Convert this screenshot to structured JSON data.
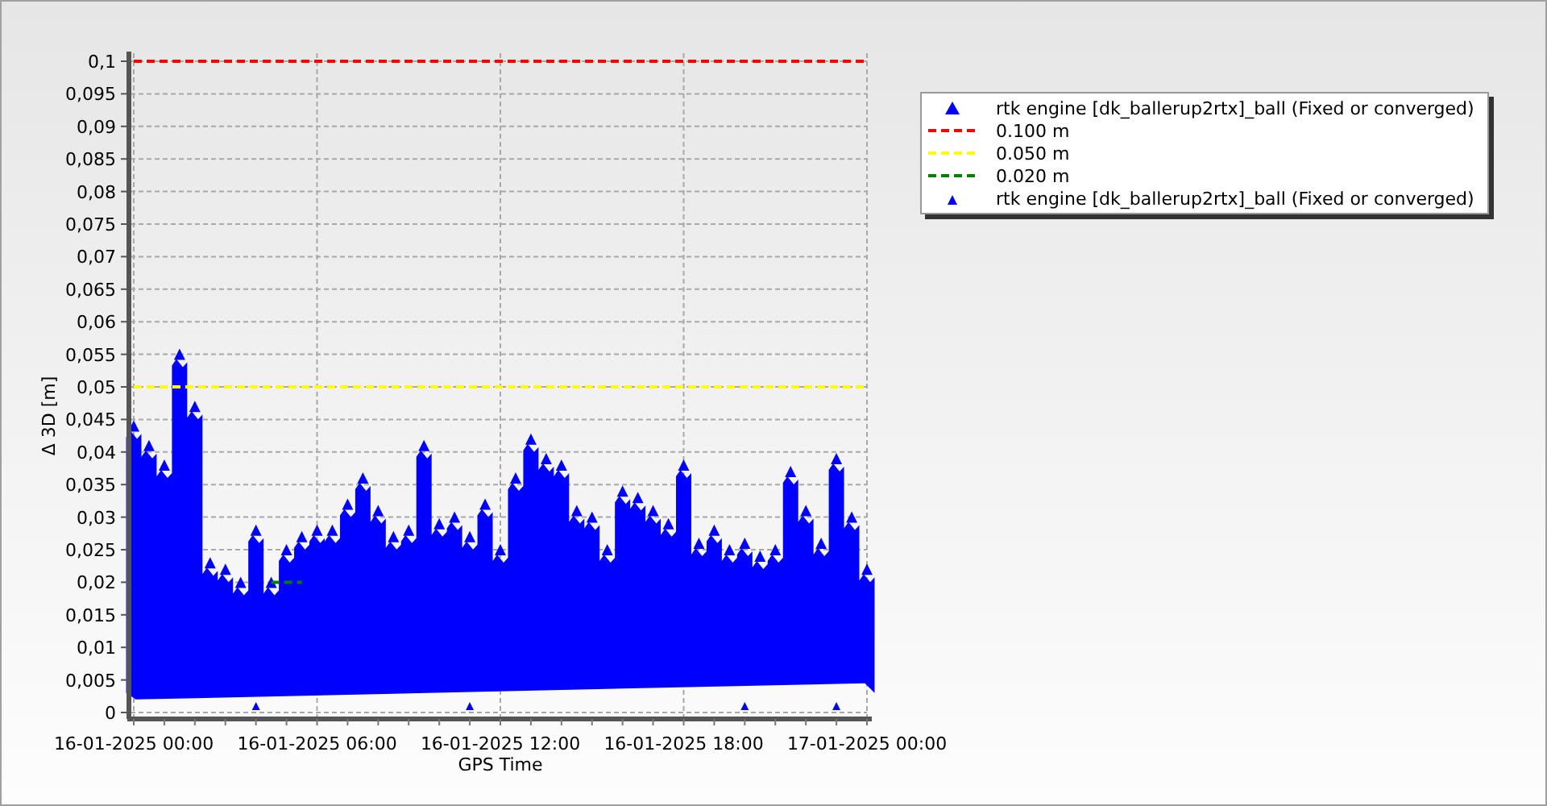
{
  "chart_data": {
    "type": "scatter",
    "grid": true,
    "xlabel": "GPS Time",
    "ylabel": "Δ 3D [m]",
    "categories": [
      "16-01-2025 00:00",
      null,
      null,
      null,
      null,
      null,
      null,
      null,
      null,
      null,
      null,
      null,
      "16-01-2025 06:00",
      null,
      null,
      null,
      null,
      null,
      null,
      null,
      null,
      null,
      null,
      null,
      "16-01-2025 12:00",
      null,
      null,
      null,
      null,
      null,
      null,
      null,
      null,
      null,
      null,
      null,
      "16-01-2025 18:00",
      null,
      null,
      null,
      null,
      null,
      null,
      null,
      null,
      null,
      null,
      null,
      "17-01-2025 00:00"
    ],
    "ylim": [
      0,
      0.1
    ],
    "yticks": [
      {
        "value": 0,
        "label": "0"
      },
      {
        "value": 0.005,
        "label": "0,005"
      },
      {
        "value": 0.01,
        "label": "0,01"
      },
      {
        "value": 0.015,
        "label": "0,015"
      },
      {
        "value": 0.02,
        "label": "0,02"
      },
      {
        "value": 0.025,
        "label": "0,025"
      },
      {
        "value": 0.03,
        "label": "0,03"
      },
      {
        "value": 0.035,
        "label": "0,035"
      },
      {
        "value": 0.04,
        "label": "0,04"
      },
      {
        "value": 0.045,
        "label": "0,045"
      },
      {
        "value": 0.05,
        "label": "0,05"
      },
      {
        "value": 0.055,
        "label": "0,055"
      },
      {
        "value": 0.06,
        "label": "0,06"
      },
      {
        "value": 0.065,
        "label": "0,065"
      },
      {
        "value": 0.07,
        "label": "0,07"
      },
      {
        "value": 0.075,
        "label": "0,075"
      },
      {
        "value": 0.08,
        "label": "0,08"
      },
      {
        "value": 0.085,
        "label": "0,085"
      },
      {
        "value": 0.09,
        "label": "0,09"
      },
      {
        "value": 0.095,
        "label": "0,095"
      },
      {
        "value": 0.1,
        "label": "0,1"
      }
    ],
    "series": [
      {
        "name": "rtk engine [dk_ballerup2rtx]_ball (Fixed or converged)",
        "type": "scatter",
        "marker": "triangle",
        "color": "#0000ff",
        "values": [
          0.044,
          0.041,
          0.038,
          0.055,
          0.047,
          0.023,
          0.022,
          0.02,
          0.028,
          0.02,
          0.025,
          0.027,
          0.028,
          0.028,
          0.032,
          0.036,
          0.031,
          0.027,
          0.028,
          0.041,
          0.029,
          0.03,
          0.027,
          0.032,
          0.025,
          0.036,
          0.042,
          0.039,
          0.038,
          0.031,
          0.03,
          0.025,
          0.034,
          0.033,
          0.031,
          0.029,
          0.038,
          0.026,
          0.028,
          0.025,
          0.026,
          0.024,
          0.025,
          0.037,
          0.031,
          0.026,
          0.039,
          0.03,
          0.022
        ]
      },
      {
        "name": "0.100 m",
        "type": "line",
        "line_style": "dashed",
        "color": "#ff0000",
        "values": [
          0.1,
          0.1,
          0.1,
          0.1,
          0.1,
          0.1,
          0.1,
          0.1,
          0.1,
          0.1,
          0.1,
          0.1,
          0.1,
          0.1,
          0.1,
          0.1,
          0.1,
          0.1,
          0.1,
          0.1,
          0.1,
          0.1,
          0.1,
          0.1,
          0.1,
          0.1,
          0.1,
          0.1,
          0.1,
          0.1,
          0.1,
          0.1,
          0.1,
          0.1,
          0.1,
          0.1,
          0.1,
          0.1,
          0.1,
          0.1,
          0.1,
          0.1,
          0.1,
          0.1,
          0.1,
          0.1,
          0.1,
          0.1,
          0.1
        ]
      },
      {
        "name": "0.050 m",
        "type": "line",
        "line_style": "dashed",
        "color": "#ffff00",
        "values": [
          0.05,
          0.05,
          0.05,
          0.05,
          0.05,
          0.05,
          0.05,
          0.05,
          0.05,
          0.05,
          0.05,
          0.05,
          0.05,
          0.05,
          0.05,
          0.05,
          0.05,
          0.05,
          0.05,
          0.05,
          0.05,
          0.05,
          0.05,
          0.05,
          0.05,
          0.05,
          0.05,
          0.05,
          0.05,
          0.05,
          0.05,
          0.05,
          0.05,
          0.05,
          0.05,
          0.05,
          0.05,
          0.05,
          0.05,
          0.05,
          0.05,
          0.05,
          0.05,
          0.05,
          0.05,
          0.05,
          0.05,
          0.05,
          0.05
        ]
      },
      {
        "name": "0.020 m",
        "type": "line",
        "line_style": "dashed",
        "color": "#008000",
        "values": [
          null,
          null,
          null,
          null,
          null,
          null,
          null,
          null,
          null,
          0.02,
          0.02,
          0.02,
          null,
          null,
          null,
          null,
          null,
          null,
          null,
          null,
          null,
          null,
          null,
          null,
          null,
          null,
          null,
          null,
          null,
          null,
          null,
          null,
          null,
          null,
          null,
          null,
          null,
          null,
          null,
          null,
          null,
          null,
          null,
          null,
          null,
          null,
          null,
          null,
          null
        ]
      },
      {
        "name": "rtk engine [dk_ballerup2rtx]_ball (Fixed or converged)",
        "type": "scatter",
        "marker": "triangle",
        "color": "#0000ff",
        "values": [
          null,
          null,
          null,
          null,
          null,
          null,
          null,
          null,
          0.001,
          null,
          null,
          null,
          null,
          null,
          null,
          null,
          null,
          null,
          null,
          null,
          null,
          null,
          0.001,
          null,
          null,
          null,
          null,
          null,
          null,
          null,
          null,
          null,
          null,
          null,
          null,
          null,
          null,
          null,
          null,
          null,
          0.001,
          null,
          null,
          null,
          null,
          null,
          0.001,
          null,
          null
        ]
      }
    ]
  }
}
